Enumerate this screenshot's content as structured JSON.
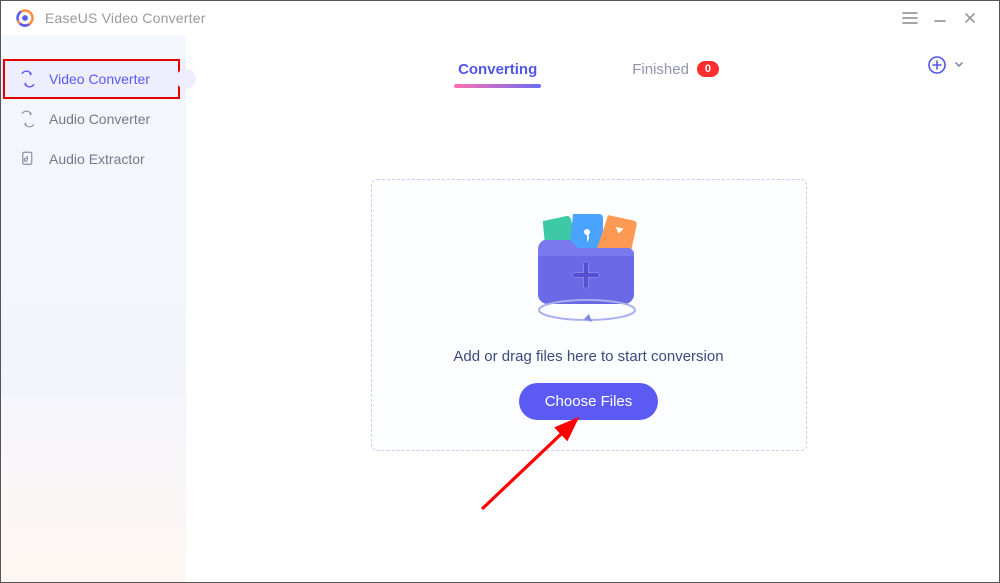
{
  "app": {
    "title": "EaseUS Video Converter"
  },
  "sidebar": {
    "items": [
      {
        "label": "Video Converter",
        "icon": "video-convert-icon",
        "active": true,
        "highlighted": true
      },
      {
        "label": "Audio Converter",
        "icon": "audio-convert-icon"
      },
      {
        "label": "Audio Extractor",
        "icon": "audio-extract-icon"
      }
    ]
  },
  "tabs": {
    "converting": {
      "label": "Converting",
      "active": true
    },
    "finished": {
      "label": "Finished",
      "count": 0
    }
  },
  "dropzone": {
    "message": "Add or drag files here to start conversion",
    "choose_label": "Choose Files"
  },
  "colors": {
    "accent": "#5b5bf3",
    "accent_text": "#5156e6",
    "badge": "#ff2d2d",
    "highlight_box": "#e30000",
    "text_muted": "#737a8c",
    "dropzone_text": "#3d4a7d"
  }
}
